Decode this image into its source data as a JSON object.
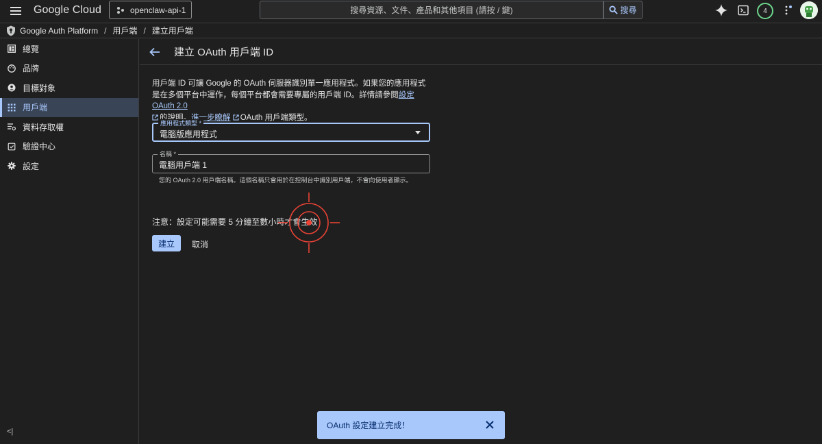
{
  "topbar": {
    "brand": "Google Cloud",
    "project": "openclaw-api-1",
    "search_placeholder": "搜尋資源、文件、產品和其他項目 (請按 / 鍵)",
    "search_button": "搜尋",
    "notifications_count": "4"
  },
  "breadcrumb": {
    "items": [
      "Google Auth Platform",
      "用戶端",
      "建立用戶端"
    ]
  },
  "sidebar": {
    "items": [
      {
        "label": "總覽",
        "icon": "dashboard-icon"
      },
      {
        "label": "品牌",
        "icon": "palette-icon"
      },
      {
        "label": "目標對象",
        "icon": "account-icon"
      },
      {
        "label": "用戶端",
        "icon": "apps-grid-icon"
      },
      {
        "label": "資料存取權",
        "icon": "data-access-icon"
      },
      {
        "label": "驗證中心",
        "icon": "verification-icon"
      },
      {
        "label": "設定",
        "icon": "gear-icon"
      }
    ],
    "active_index": 3,
    "collapse_label": "<|"
  },
  "page": {
    "title": "建立 OAuth 用戶端 ID",
    "desc_part1": "用戶端 ID 可讓 Google 的 OAuth 伺服器識別單一應用程式。如果您的應用程式是在多個平台中運作，每個平台都會需要專屬的用戶端 ID。詳情請參閱",
    "desc_link1": "設定 OAuth 2.0",
    "desc_part2": "的說明。",
    "desc_link2": "進一步瞭解",
    "desc_part3": "OAuth 用戶端類型。",
    "app_type_label": "應用程式類型 *",
    "app_type_value": "電腦版應用程式",
    "name_label": "名稱 *",
    "name_value": "電腦用戶端 1",
    "name_helper": "您的 OAuth 2.0 用戶端名稱。這個名稱只會用於在控制台中識別用戶端，不會向使用者顯示。",
    "note": "注意：設定可能需要 5 分鐘至數小時才會生效",
    "create_button": "建立",
    "cancel_button": "取消"
  },
  "toast": {
    "message": "OAuth 設定建立完成！"
  },
  "colors": {
    "accent": "#a8c7fa",
    "background": "#1f1f1f",
    "active_nav_bg": "#394457",
    "target_red": "#ea4335"
  }
}
